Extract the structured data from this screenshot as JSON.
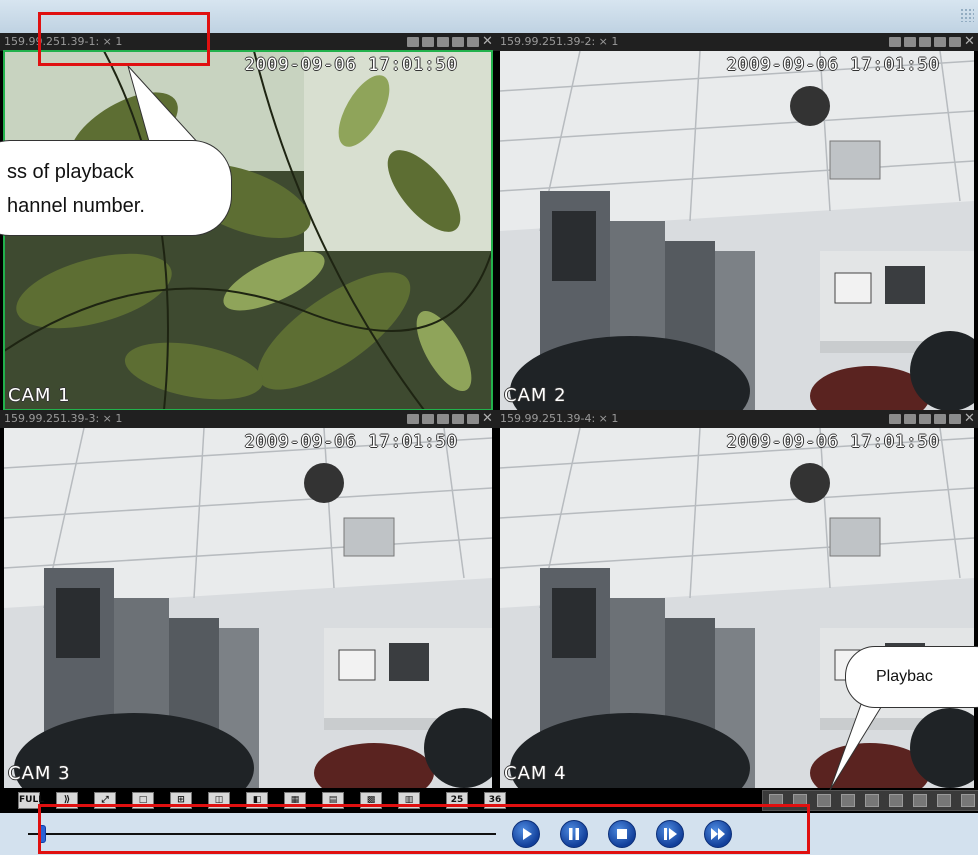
{
  "window": {
    "cells": [
      {
        "title": "159.99.251.39-1: × 1",
        "timestamp": "2009-09-06 17:01:50",
        "cam": "CAM 1",
        "scene": "plant"
      },
      {
        "title": "159.99.251.39-2: × 1",
        "timestamp": "2009-09-06 17:01:50",
        "cam": "CAM 2",
        "scene": "room"
      },
      {
        "title": "159.99.251.39-3: × 1",
        "timestamp": "2009-09-06 17:01:50",
        "cam": "CAM 3",
        "scene": "room"
      },
      {
        "title": "159.99.251.39-4: × 1",
        "timestamp": "2009-09-06 17:01:50",
        "cam": "CAM 4",
        "scene": "room"
      }
    ],
    "cell_tool_icons": [
      "record-icon",
      "snapshot-icon",
      "zoom-icon",
      "camera-icon",
      "audio-icon",
      "close-icon"
    ],
    "selected_cell": 1
  },
  "layout_buttons": [
    {
      "label": "FULL",
      "icon": "fullscreen-icon"
    },
    {
      "label": "",
      "icon": "auto-switch-icon"
    },
    {
      "label": "",
      "icon": "fit-icon"
    },
    {
      "label": "",
      "icon": "layout-1-icon"
    },
    {
      "label": "",
      "icon": "layout-4-icon"
    },
    {
      "label": "",
      "icon": "layout-6-icon"
    },
    {
      "label": "",
      "icon": "layout-8-icon"
    },
    {
      "label": "",
      "icon": "layout-9-icon"
    },
    {
      "label": "",
      "icon": "layout-10-icon"
    },
    {
      "label": "",
      "icon": "layout-16-icon"
    },
    {
      "label": "",
      "icon": "layout-20-icon"
    },
    {
      "label": "25",
      "icon": "layout-25-icon"
    },
    {
      "label": "36",
      "icon": "layout-36-icon"
    }
  ],
  "playback": {
    "progress": 0.03,
    "buttons": [
      {
        "name": "play-button",
        "icon": "play-icon"
      },
      {
        "name": "pause-button",
        "icon": "pause-icon"
      },
      {
        "name": "stop-button",
        "icon": "stop-icon"
      },
      {
        "name": "step-forward-button",
        "icon": "step-forward-icon"
      },
      {
        "name": "fast-forward-button",
        "icon": "fast-forward-icon"
      }
    ]
  },
  "callouts": {
    "left_line1": "ss of playback",
    "left_line2": "hannel number.",
    "right": "Playbac"
  },
  "colors": {
    "selected_border": "#22b14c",
    "annotation_red": "#e01010",
    "control_blue": "#1e56c4"
  }
}
